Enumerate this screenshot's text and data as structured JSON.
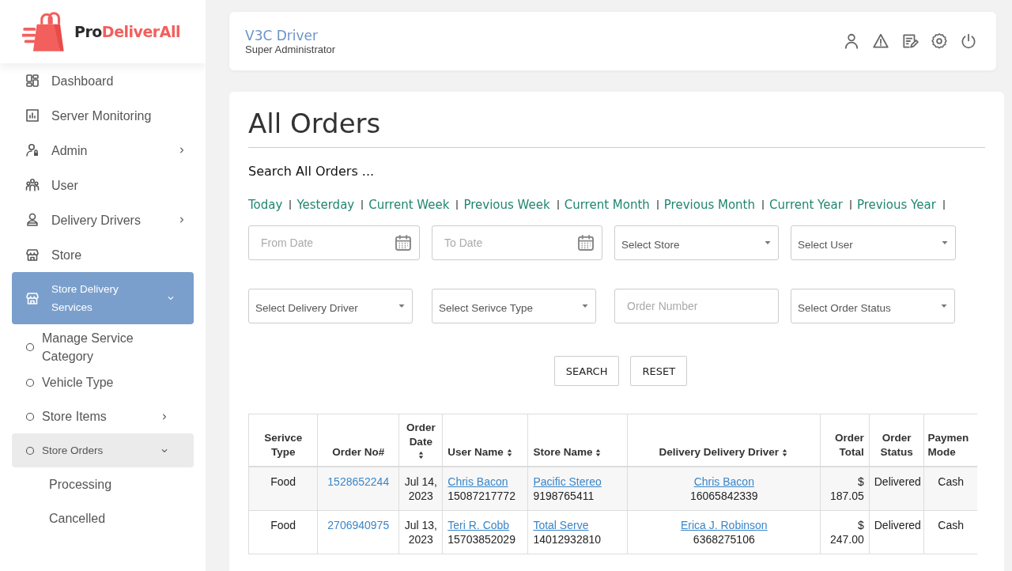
{
  "brand": {
    "part_1": "Pro",
    "part_2": "DeliverAll"
  },
  "sidebar": {
    "items": [
      {
        "label": "Dashboard",
        "selected": false
      },
      {
        "label": "Server Monitoring",
        "selected": false
      },
      {
        "label": "Admin",
        "selected": false,
        "expanded": false
      },
      {
        "label": "User",
        "selected": false
      },
      {
        "label": "Delivery Drivers",
        "selected": false,
        "expanded": false
      },
      {
        "label": "Store",
        "selected": false
      },
      {
        "label": "Store Delivery Services",
        "selected": true,
        "expanded": true,
        "children": [
          {
            "label": "Manage Service Category",
            "selected": false
          },
          {
            "label": "Vehicle Type",
            "selected": false
          },
          {
            "label": "Store Items",
            "selected": false,
            "expanded": false
          },
          {
            "label": "Store Orders",
            "selected": true,
            "expanded": true,
            "children": [
              {
                "label": "Processing",
                "selected": false
              },
              {
                "label": "Cancelled",
                "selected": false
              }
            ]
          }
        ]
      }
    ]
  },
  "header": {
    "user_name": "V3C Driver",
    "role": "Super Administrator"
  },
  "page": {
    "title": "All Orders",
    "search_heading": "Search All Orders ...",
    "date_shortcuts": [
      "Today",
      "Yesterday",
      "Current Week",
      "Previous Week",
      "Current Month",
      "Previous Month",
      "Current Year",
      "Previous Year"
    ],
    "filters": [
      {
        "kind": "date",
        "placeholder": "From Date"
      },
      {
        "kind": "date",
        "placeholder": "To Date"
      },
      {
        "kind": "select",
        "value": "Select Store"
      },
      {
        "kind": "select",
        "value": "Select User"
      },
      {
        "kind": "select",
        "value": "Select Delivery Driver"
      },
      {
        "kind": "select",
        "value": "Select Serivce Type"
      },
      {
        "kind": "text",
        "placeholder": "Order Number"
      },
      {
        "kind": "select",
        "value": "Select Order Status"
      }
    ],
    "buttons": [
      "SEARCH",
      "RESET"
    ]
  },
  "table": {
    "columns": [
      {
        "label": "Serivce Type",
        "sortable": false
      },
      {
        "label": "Order No#",
        "sortable": false
      },
      {
        "label": "Order Date",
        "sortable": true
      },
      {
        "label": "User Name",
        "sortable": true
      },
      {
        "label": "Store Name",
        "sortable": true
      },
      {
        "label": "Delivery Delivery Driver",
        "sortable": true
      },
      {
        "label": "Order Total",
        "sortable": false
      },
      {
        "label": "Order Status",
        "sortable": false
      },
      {
        "label": "Paymen Mode",
        "sortable": false
      }
    ],
    "rows": [
      {
        "service_type": "Food",
        "order_no": "1528652244",
        "order_date": "Jul 14, 2023",
        "user": {
          "name": "Chris Bacon",
          "phone": "15087217772"
        },
        "store": {
          "name": "Pacific Stereo",
          "phone": "9198765411"
        },
        "driver": {
          "name": "Chris Bacon",
          "phone": "16065842339"
        },
        "order_total": "$ 187.05",
        "order_status": "Delivered",
        "payment_mode": "Cash"
      },
      {
        "service_type": "Food",
        "order_no": "2706940975",
        "order_date": "Jul 13, 2023",
        "user": {
          "name": "Teri R. Cobb",
          "phone": "15703852029"
        },
        "store": {
          "name": "Total Serve",
          "phone": "14012932810"
        },
        "driver": {
          "name": "Erica J. Robinson",
          "phone": "6368275106"
        },
        "order_total": "$ 247.00",
        "order_status": "Delivered",
        "payment_mode": "Cash"
      }
    ]
  }
}
